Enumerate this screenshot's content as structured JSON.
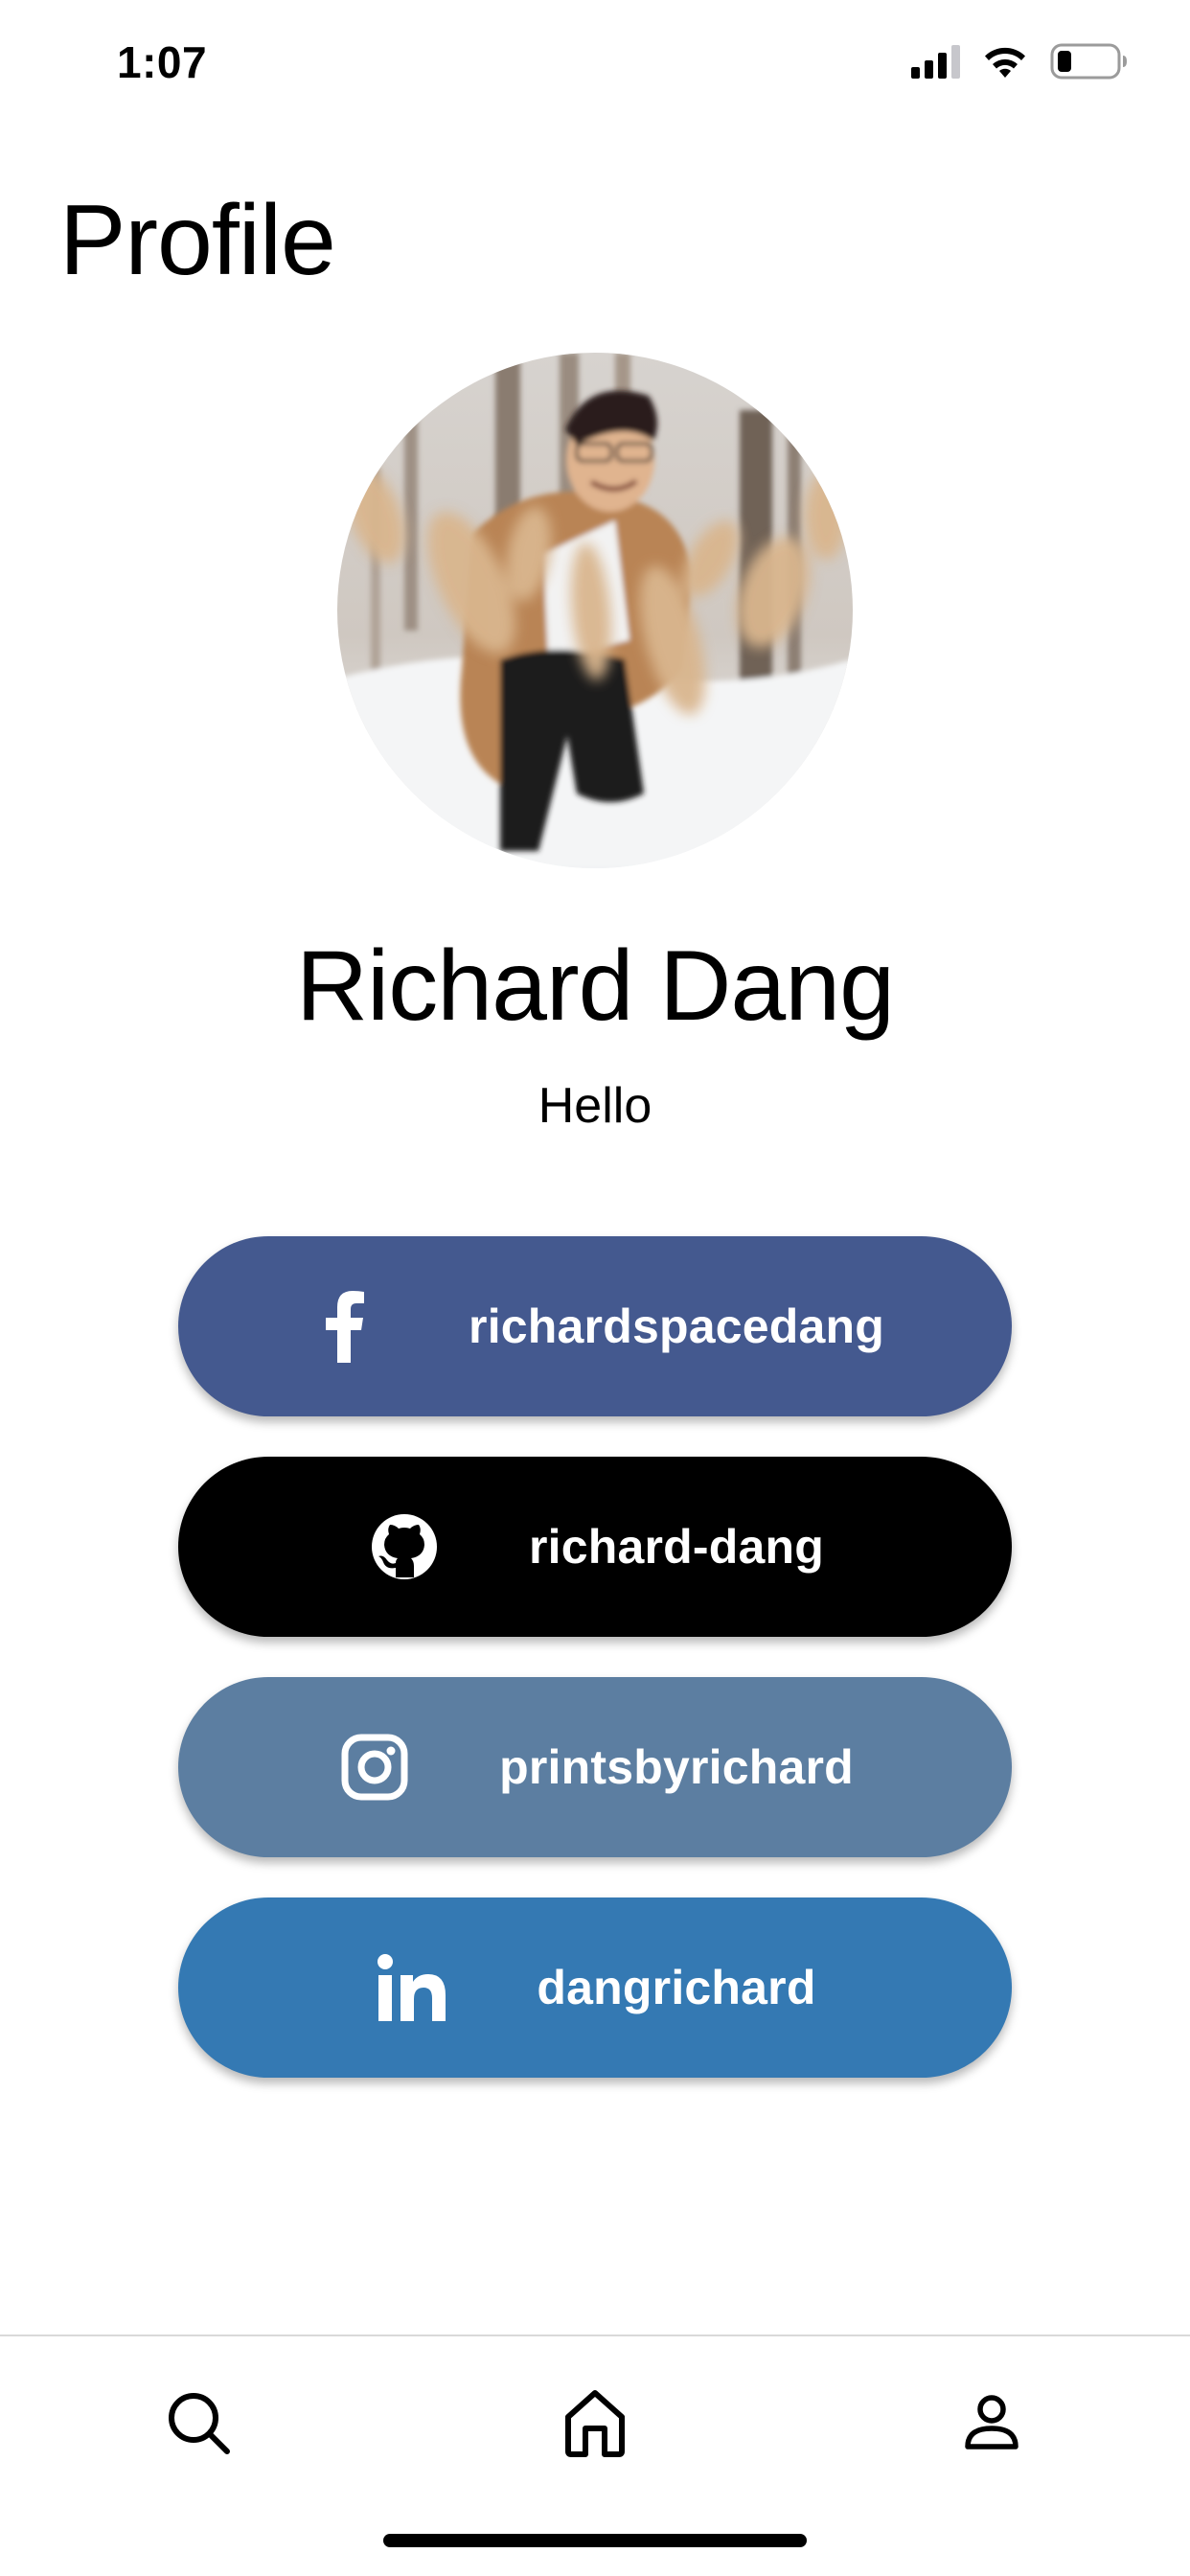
{
  "status_bar": {
    "time": "1:07",
    "icons": [
      "cellular-signal-icon",
      "wifi-icon",
      "battery-icon"
    ]
  },
  "page": {
    "title": "Profile"
  },
  "profile": {
    "name": "Richard Dang",
    "bio": "Hello",
    "avatar_alt": "profile photo"
  },
  "social_links": [
    {
      "platform": "facebook",
      "icon": "facebook-icon",
      "label": "richardspacedang",
      "color": "#44598f"
    },
    {
      "platform": "github",
      "icon": "github-icon",
      "label": "richard-dang",
      "color": "#000000"
    },
    {
      "platform": "instagram",
      "icon": "instagram-icon",
      "label": "printsbyrichard",
      "color": "#5c7ea1"
    },
    {
      "platform": "linkedin",
      "icon": "linkedin-icon",
      "label": "dangrichard",
      "color": "#3479b3"
    }
  ],
  "tab_bar": {
    "tabs": [
      {
        "name": "search",
        "icon": "search-icon"
      },
      {
        "name": "home",
        "icon": "home-icon"
      },
      {
        "name": "profile",
        "icon": "person-icon"
      }
    ]
  }
}
